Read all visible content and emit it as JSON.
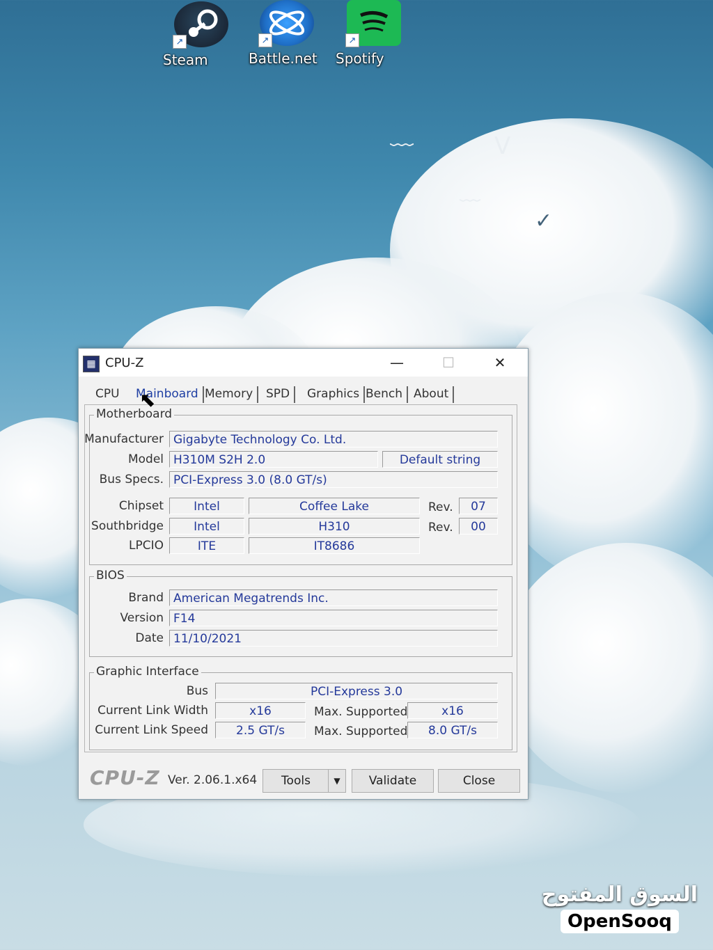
{
  "desktop": {
    "icons": [
      {
        "label": "Steam",
        "icon": "steam-icon",
        "color": "#1b2838"
      },
      {
        "label": "Battle.net",
        "icon": "battlenet-icon",
        "color": "#1f6fc7"
      },
      {
        "label": "Spotify",
        "icon": "spotify-icon",
        "color": "#1db954"
      }
    ]
  },
  "window": {
    "title": "CPU-Z",
    "controls": {
      "minimize": "—",
      "maximize": "☐",
      "close": "✕"
    },
    "tabs": [
      "CPU",
      "Mainboard",
      "Memory",
      "SPD",
      "Graphics",
      "Bench",
      "About"
    ],
    "active_tab": "Mainboard",
    "motherboard": {
      "title": "Motherboard",
      "manufacturer_label": "Manufacturer",
      "manufacturer": "Gigabyte Technology Co. Ltd.",
      "model_label": "Model",
      "model": "H310M S2H 2.0",
      "model_extra": "Default string",
      "bus_label": "Bus Specs.",
      "bus": "PCI-Express 3.0 (8.0 GT/s)",
      "chipset_label": "Chipset",
      "chipset_vendor": "Intel",
      "chipset_name": "Coffee Lake",
      "chipset_rev_label": "Rev.",
      "chipset_rev": "07",
      "southbridge_label": "Southbridge",
      "southbridge_vendor": "Intel",
      "southbridge_name": "H310",
      "southbridge_rev_label": "Rev.",
      "southbridge_rev": "00",
      "lpcio_label": "LPCIO",
      "lpcio_vendor": "ITE",
      "lpcio_name": "IT8686"
    },
    "bios": {
      "title": "BIOS",
      "brand_label": "Brand",
      "brand": "American Megatrends Inc.",
      "version_label": "Version",
      "version": "F14",
      "date_label": "Date",
      "date": "11/10/2021"
    },
    "graphic": {
      "title": "Graphic Interface",
      "bus_label": "Bus",
      "bus": "PCI-Express 3.0",
      "width_label": "Current Link Width",
      "width": "x16",
      "width_max_label": "Max. Supported",
      "width_max": "x16",
      "speed_label": "Current Link Speed",
      "speed": "2.5 GT/s",
      "speed_max_label": "Max. Supported",
      "speed_max": "8.0 GT/s"
    },
    "footer": {
      "logo": "CPU-Z",
      "version": "Ver. 2.06.1.x64",
      "tools": "Tools",
      "validate": "Validate",
      "close": "Close"
    }
  },
  "watermark": {
    "arabic": "السوق المفتوح",
    "english": "OpenSooq"
  }
}
